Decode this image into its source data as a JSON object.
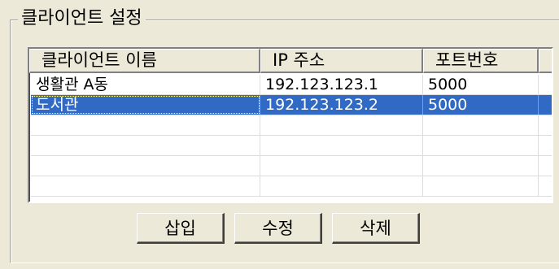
{
  "group": {
    "title": "클라이언트 설정"
  },
  "list": {
    "columns": [
      {
        "label": "클라이언트 이름"
      },
      {
        "label": "IP 주소"
      },
      {
        "label": "포트번호"
      }
    ],
    "rows": [
      {
        "name": "생활관 A동",
        "ip": "192.123.123.1",
        "port": "5000",
        "selected": false
      },
      {
        "name": "도서관",
        "ip": "192.123.123.2",
        "port": "5000",
        "selected": true
      }
    ],
    "empty_rows": 4
  },
  "buttons": {
    "insert_label": "삽입",
    "edit_label": "수정",
    "delete_label": "삭제"
  },
  "colors": {
    "window_bg": "#ece9d8",
    "selection_bg": "#316ac5",
    "selection_text": "#ffffff"
  }
}
